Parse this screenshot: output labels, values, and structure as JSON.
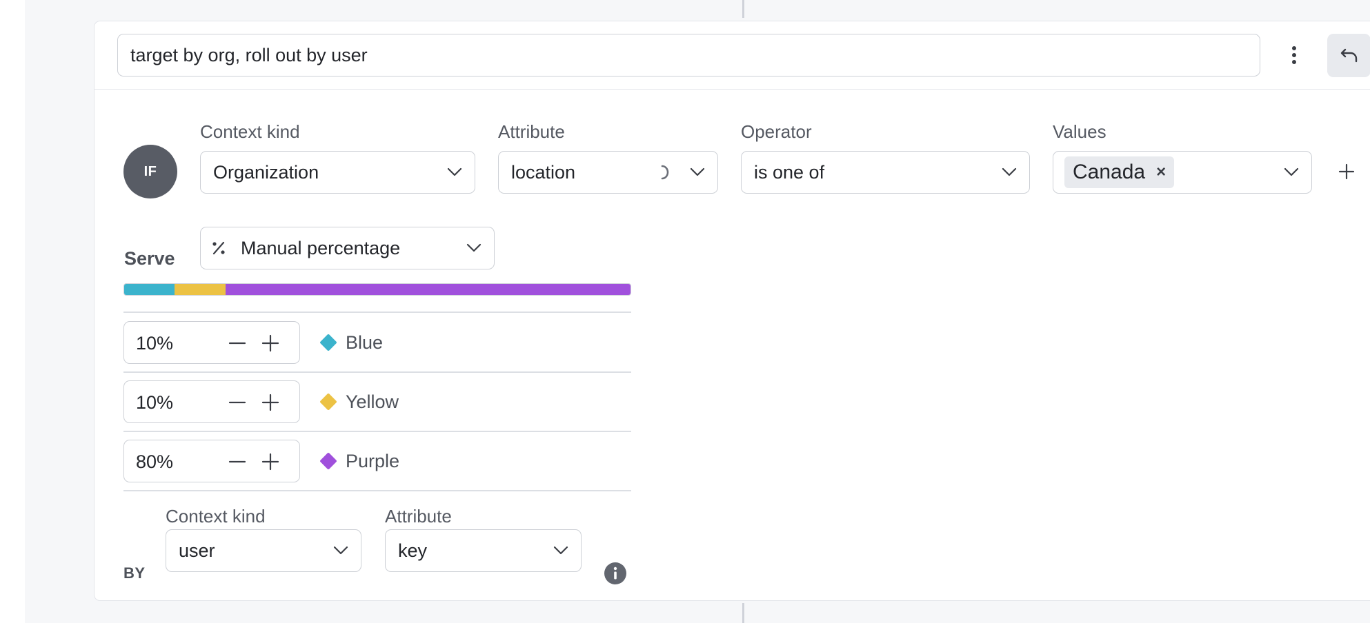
{
  "rule": {
    "name": "target by org, roll out by user"
  },
  "clause": {
    "if_label": "IF",
    "context_kind": {
      "label": "Context kind",
      "value": "Organization"
    },
    "attribute": {
      "label": "Attribute",
      "value": "location"
    },
    "operator": {
      "label": "Operator",
      "value": "is one of"
    },
    "values": {
      "label": "Values",
      "chips": [
        "Canada"
      ],
      "chip_remove_symbol": "×"
    }
  },
  "serve": {
    "label": "Serve",
    "mode": "Manual percentage",
    "variations": [
      {
        "name": "Blue",
        "percent": "10%",
        "weight": 10,
        "color": "#3bb3cc"
      },
      {
        "name": "Yellow",
        "percent": "10%",
        "weight": 10,
        "color": "#ecc244"
      },
      {
        "name": "Purple",
        "percent": "80%",
        "weight": 80,
        "color": "#a050dc"
      }
    ]
  },
  "bucket_by": {
    "label": "BY",
    "context_kind": {
      "label": "Context kind",
      "value": "user"
    },
    "attribute": {
      "label": "Attribute",
      "value": "key"
    }
  },
  "icons": {
    "kebab": "more-vertical-icon",
    "undo": "undo-icon",
    "chevron": "chevron-down-icon",
    "loading": "loading-spinner-icon",
    "add": "plus-icon",
    "percentage": "percent-icon",
    "info": "info-icon"
  },
  "colors": {
    "badge": "#585c65",
    "border": "#cdd0d6",
    "chip_bg": "#e8eaee"
  }
}
